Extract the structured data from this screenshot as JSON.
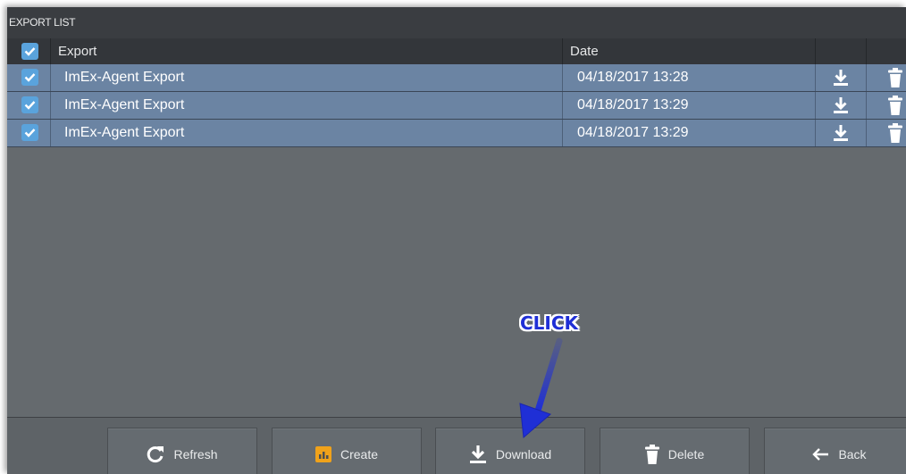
{
  "window": {
    "title": "EXPORT LIST"
  },
  "table": {
    "columns": {
      "export": "Export",
      "date": "Date"
    },
    "rows": [
      {
        "name": "ImEx-Agent Export",
        "date": "04/18/2017 13:28",
        "checked": true
      },
      {
        "name": "ImEx-Agent Export",
        "date": "04/18/2017 13:29",
        "checked": true
      },
      {
        "name": "ImEx-Agent Export",
        "date": "04/18/2017 13:29",
        "checked": true
      }
    ]
  },
  "footer": {
    "refresh_label": "Refresh",
    "create_label": "Create",
    "download_label": "Download",
    "delete_label": "Delete",
    "back_label": "Back"
  },
  "annotation": {
    "callout_text": "CLICK",
    "color": "#1f2fd6"
  },
  "colors": {
    "row_selected": "#6b84a3",
    "checkbox": "#5aa3dc",
    "create_icon": "#f0a21a"
  }
}
